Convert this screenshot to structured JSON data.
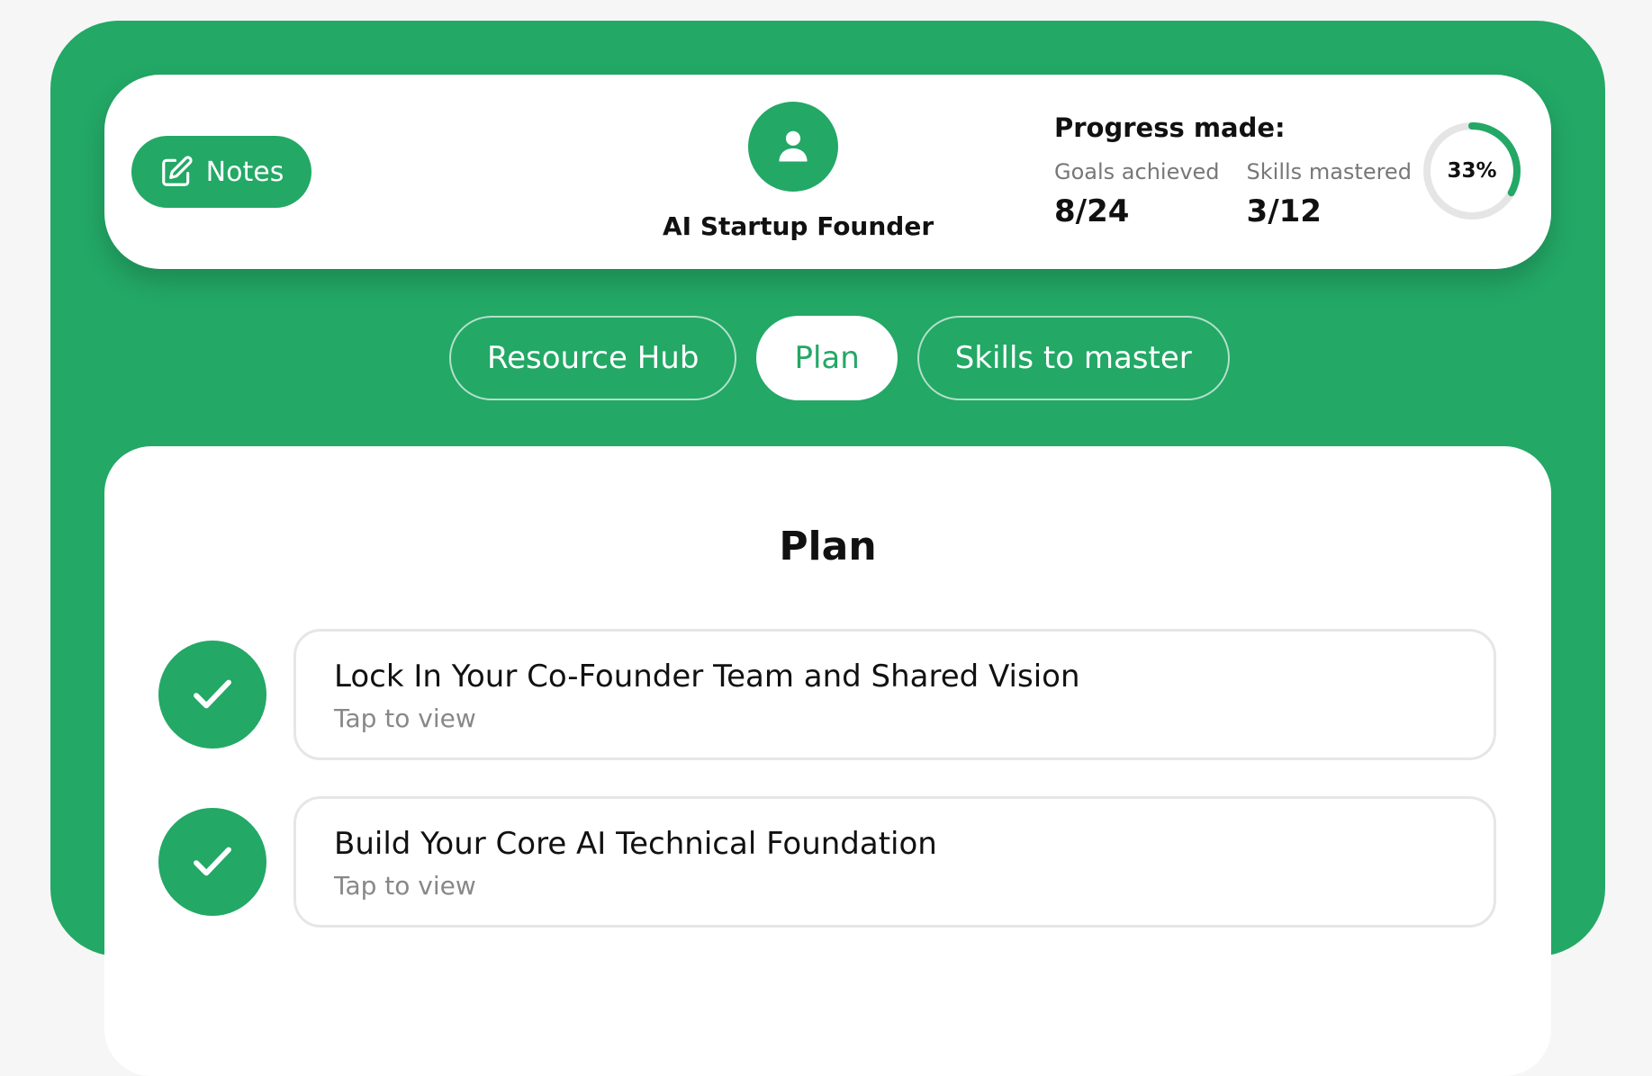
{
  "header": {
    "notes_label": "Notes",
    "role_title": "AI Startup Founder",
    "progress_title": "Progress made:",
    "goals_label": "Goals achieved",
    "goals_value": "8/24",
    "skills_label": "Skills mastered",
    "skills_value": "3/12",
    "progress_percent_label": "33%",
    "progress_fraction": 0.33
  },
  "tabs": [
    {
      "label": "Resource Hub",
      "active": false
    },
    {
      "label": "Plan",
      "active": true
    },
    {
      "label": "Skills to master",
      "active": false
    }
  ],
  "plan": {
    "title": "Plan",
    "items": [
      {
        "title": "Lock In Your Co-Founder Team and Shared Vision",
        "subtitle": "Tap to view",
        "completed": true
      },
      {
        "title": "Build Your Core AI Technical Foundation",
        "subtitle": "Tap to view",
        "completed": true
      }
    ]
  },
  "icons": {
    "notes": "edit-pencil-icon",
    "avatar": "user-icon",
    "check": "checkmark-icon"
  },
  "colors": {
    "brand_green": "#23a866",
    "ring_track": "#e5e5e5"
  }
}
